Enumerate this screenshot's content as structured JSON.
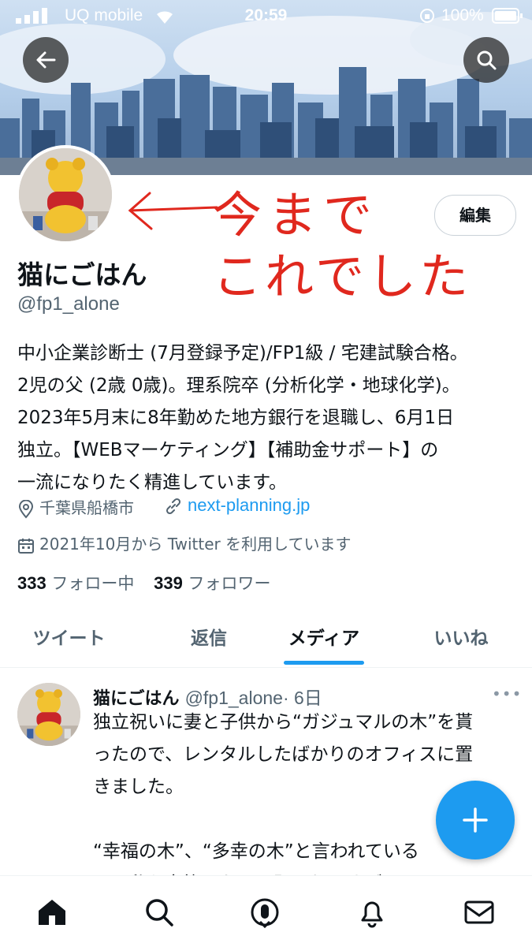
{
  "status_bar": {
    "carrier": "UQ mobile",
    "time": "20:59",
    "battery": "100%"
  },
  "profile": {
    "edit_label": "編集",
    "display_name": "猫にごはん",
    "handle": "@fp1_alone",
    "bio_lines": [
      "中小企業診断士 (7月登録予定)/FP1級 / 宅建試験合格。",
      "2児の父 (2歳 0歳)。理系院卒 (分析化学・地球化学)。",
      "2023年5月末に8年勤めた地方銀行を退職し、6月1日",
      "独立。【WEBマーケティング】【補助金サポート】の",
      "一流になりたく精進しています。"
    ],
    "location": "千葉県船橋市",
    "website": "next-planning.jp",
    "joined": "2021年10月から Twitter を利用しています",
    "following_count": "333",
    "following_label": "フォロー中",
    "followers_count": "339",
    "followers_label": "フォロワー"
  },
  "annotation": {
    "line1": "今まで",
    "line2": "これでした",
    "color": "#e0281e"
  },
  "tabs": [
    {
      "label": "ツイート"
    },
    {
      "label": "返信"
    },
    {
      "label": "メディア"
    },
    {
      "label": "いいね"
    }
  ],
  "active_tab": "メディア",
  "tweet": {
    "name": "猫にごはん",
    "handle": "@fp1_alone",
    "time": "· 6日",
    "lines": [
      "独立祝いに妻と子供から“ガジュマルの木”を貰",
      "ったので、レンタルしたばかりのオフィスに置",
      "きました。",
      "",
      "“幸福の木”、“多幸の木”と言われている",
      "で。私も家族のために頑張りますが、Twitter"
    ]
  },
  "colors": {
    "accent": "#1d9bf0",
    "text": "#0f1419",
    "muted": "#536471"
  },
  "icons": [
    "back-arrow-icon",
    "search-icon",
    "location-pin-icon",
    "link-icon",
    "calendar-icon",
    "plus-icon",
    "home-icon",
    "spaces-icon",
    "bell-icon",
    "mail-icon"
  ]
}
